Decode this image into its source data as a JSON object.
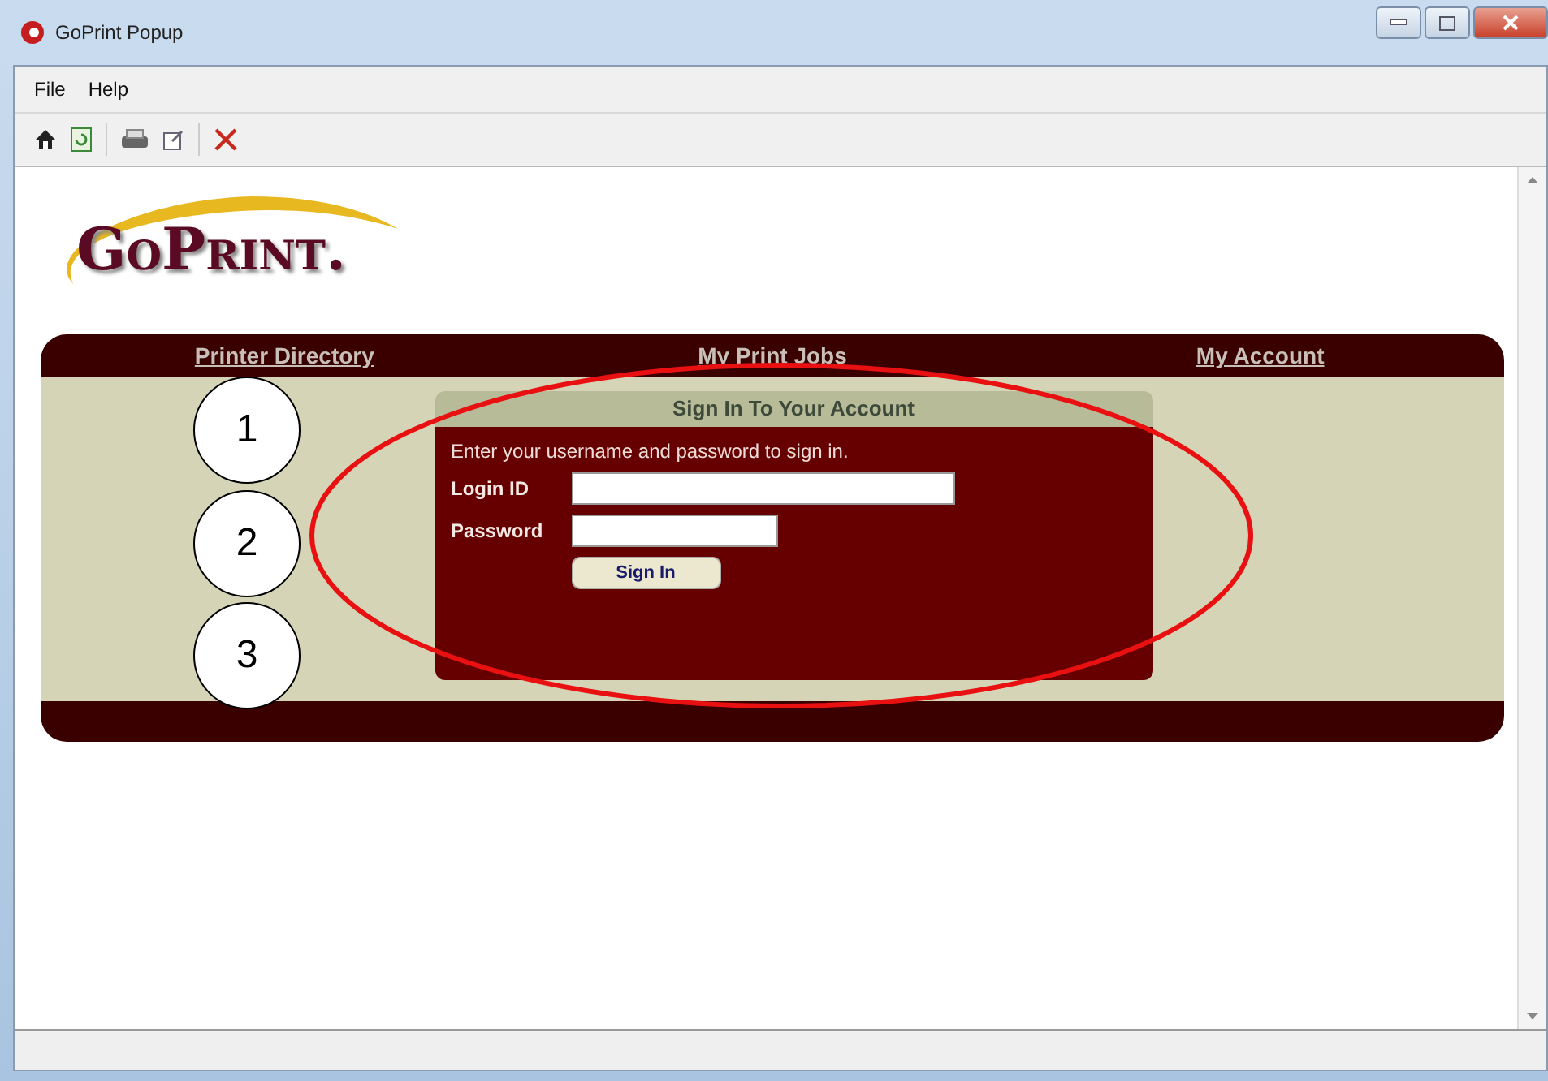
{
  "window": {
    "title": "GoPrint Popup"
  },
  "menu": [
    {
      "label": "File"
    },
    {
      "label": "Help"
    }
  ],
  "toolbar": [
    {
      "kind": "home"
    },
    {
      "kind": "refresh"
    },
    {
      "kind": "sep"
    },
    {
      "kind": "print"
    },
    {
      "kind": "edit"
    },
    {
      "kind": "sep"
    },
    {
      "kind": "close"
    }
  ],
  "logo": "GoPrint.",
  "nav": [
    "Printer Directory",
    "My Print Jobs",
    "My Account"
  ],
  "signin": {
    "title": "Sign In To Your Account",
    "intro": "Enter your username and password to sign in.",
    "login_label": "Login ID",
    "password_label": "Password",
    "button": "Sign In"
  },
  "annotations": [
    "1",
    "2",
    "3"
  ]
}
